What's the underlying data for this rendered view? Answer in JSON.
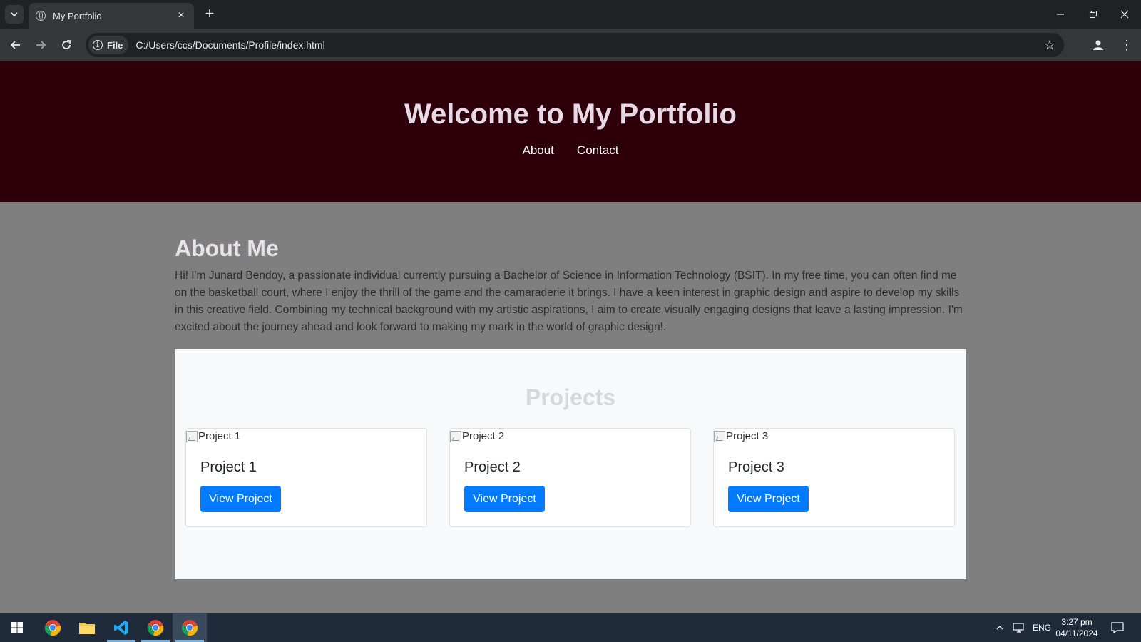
{
  "browser": {
    "tab_title": "My Portfolio",
    "new_tab_symbol": "+",
    "chip_label": "File",
    "url": "C:/Users/ccs/Documents/Profile/index.html"
  },
  "page": {
    "title": "Welcome to My Portfolio",
    "nav": [
      {
        "label": "About"
      },
      {
        "label": "Contact"
      }
    ],
    "about": {
      "heading": "About Me",
      "text": "Hi! I'm Junard Bendoy, a passionate individual currently pursuing a Bachelor of Science in Information Technology (BSIT). In my free time, you can often find me on the basketball court, where I enjoy the thrill of the game and the camaraderie it brings. I have a keen interest in graphic design and aspire to develop my skills in this creative field. Combining my technical background with my artistic aspirations, I aim to create visually engaging designs that leave a lasting impression. I'm excited about the journey ahead and look forward to making my mark in the world of graphic design!."
    },
    "projects": {
      "heading": "Projects",
      "items": [
        {
          "image_alt": "Project 1",
          "title": "Project 1",
          "button": "View Project"
        },
        {
          "image_alt": "Project 2",
          "title": "Project 2",
          "button": "View Project"
        },
        {
          "image_alt": "Project 3",
          "title": "Project 3",
          "button": "View Project"
        }
      ]
    }
  },
  "taskbar": {
    "language": "ENG",
    "time": "3:27 pm",
    "date": "04/11/2024"
  },
  "colors": {
    "header_bg": "#2e000a",
    "page_bg": "#7f7f7f",
    "button_primary": "#007bff"
  }
}
